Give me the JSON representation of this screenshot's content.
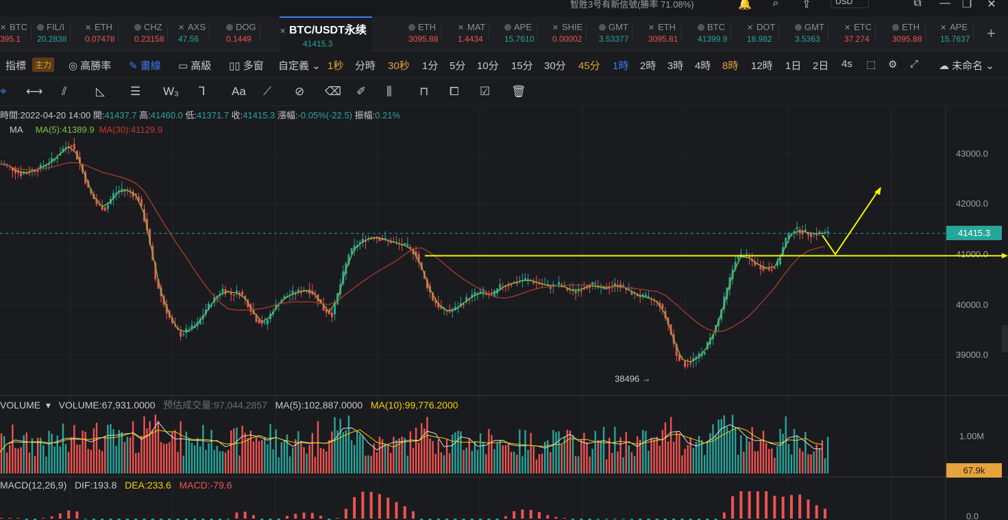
{
  "topbar": {
    "hint": "智胜3号有新信號(勝率 71.08%)",
    "currency": "USD"
  },
  "tickers": [
    {
      "name": "BTC",
      "price": "395.1",
      "dir": "dn"
    },
    {
      "name": "FIL/I",
      "price": "20.2838",
      "dir": "up"
    },
    {
      "name": "ETH",
      "price": "0.07478",
      "dir": "dn"
    },
    {
      "name": "CHZ",
      "price": "0.23158",
      "dir": "dn"
    },
    {
      "name": "AXS",
      "price": "47.56",
      "dir": "up"
    },
    {
      "name": "DOG",
      "price": "0.1449",
      "dir": "dn"
    },
    {
      "name": "BTC/USDT永续",
      "price": "41415.3",
      "dir": "up",
      "active": true
    },
    {
      "name": "ETH",
      "price": "3095.88",
      "dir": "dn"
    },
    {
      "name": "MAT",
      "price": "1.4434",
      "dir": "dn"
    },
    {
      "name": "APE",
      "price": "15.7610",
      "dir": "up"
    },
    {
      "name": "SHIE",
      "price": "0.00002",
      "dir": "dn"
    },
    {
      "name": "GMT",
      "price": "3.53377",
      "dir": "up"
    },
    {
      "name": "ETH",
      "price": "3095.81",
      "dir": "dn"
    },
    {
      "name": "BTC",
      "price": "41399.9",
      "dir": "up"
    },
    {
      "name": "DOT",
      "price": "18.982",
      "dir": "up"
    },
    {
      "name": "GMT",
      "price": "3.5363",
      "dir": "up"
    },
    {
      "name": "ETC",
      "price": "37.274",
      "dir": "dn"
    },
    {
      "name": "ETH",
      "price": "3095.88",
      "dir": "dn"
    },
    {
      "name": "APE",
      "price": "15.7637",
      "dir": "up"
    }
  ],
  "toolbar": {
    "indicators": "指標",
    "main_badge": "主力",
    "win_rate": "高勝率",
    "draw": "畫線",
    "advanced": "高級",
    "multi_window": "多窗",
    "custom": "自定義",
    "intervals": [
      "1秒",
      "分時",
      "30秒",
      "1分",
      "5分",
      "10分",
      "15分",
      "30分",
      "45分",
      "1時",
      "2時",
      "3時",
      "4時",
      "8時",
      "12時",
      "1日",
      "2日",
      "4s"
    ],
    "unnamed": "未命名"
  },
  "info_bar": {
    "time_label": "時間:",
    "time": "2022-04-20 14:00",
    "open_label": "開:",
    "open": "41437.7",
    "high_label": "高:",
    "high": "41460.0",
    "low_label": "低:",
    "low": "41371.7",
    "close_label": "收:",
    "close": "41415.3",
    "change_label": "漲幅:",
    "change": "-0.05%(-22.5)",
    "amp_label": "振幅:",
    "amp": "0.21%"
  },
  "ma_legend": {
    "label": "MA",
    "ma5": "MA(5):41389.9",
    "ma30": "MA(30):41129.9"
  },
  "price_axis": [
    "43000.0",
    "42000.0",
    "41000.0",
    "40000.0",
    "39000.0"
  ],
  "current_price": "41415.3",
  "min_label": "38496 →",
  "volume": {
    "label": "VOLUME",
    "value": "VOLUME:67,931.0000",
    "est_label": "预估成交量:97,044.2857",
    "ma5": "MA(5):102,887.0000",
    "ma10": "MA(10):99,776.2000",
    "axis": "1.00M",
    "current": "67.9k"
  },
  "macd": {
    "label": "MACD(12,26,9)",
    "dif": "DIF:193.8",
    "dea": "DEA:233.6",
    "macd": "MACD:-79.6",
    "axis": "0.0"
  },
  "colors": {
    "up": "#26a69a",
    "down": "#ef5350",
    "ma5": "#7cc242",
    "ma30": "#b03a2e",
    "annotation": "#f5f500",
    "accent": "#3c7cf0"
  },
  "chart_data": {
    "type": "candlestick",
    "symbol": "BTC/USDT",
    "interval": "1時",
    "ylim": [
      38300,
      43300
    ],
    "support_line": 40970,
    "closes": [
      42800,
      42700,
      42600,
      42650,
      42700,
      42800,
      42900,
      43100,
      43200,
      42800,
      42300,
      42000,
      41900,
      42200,
      42300,
      42250,
      42100,
      41500,
      40500,
      40000,
      39600,
      39400,
      39500,
      39600,
      39900,
      40100,
      40300,
      40200,
      40250,
      40000,
      39700,
      39600,
      39900,
      40100,
      40200,
      40250,
      40300,
      40200,
      39900,
      39800,
      40400,
      41000,
      41200,
      41300,
      41350,
      41300,
      41250,
      41200,
      41150,
      41000,
      40500,
      40100,
      39900,
      39850,
      39950,
      40100,
      40200,
      40250,
      40150,
      40350,
      40400,
      40450,
      40500,
      40450,
      40400,
      40350,
      40400,
      40300,
      40250,
      40350,
      40400,
      40300,
      40350,
      40400,
      40300,
      40200,
      40150,
      40100,
      40000,
      39600,
      39000,
      38800,
      38900,
      39000,
      39300,
      39700,
      40300,
      40900,
      41000,
      40850,
      40750,
      40700,
      40800,
      41300,
      41500,
      41450,
      41400,
      41420,
      41415
    ]
  }
}
